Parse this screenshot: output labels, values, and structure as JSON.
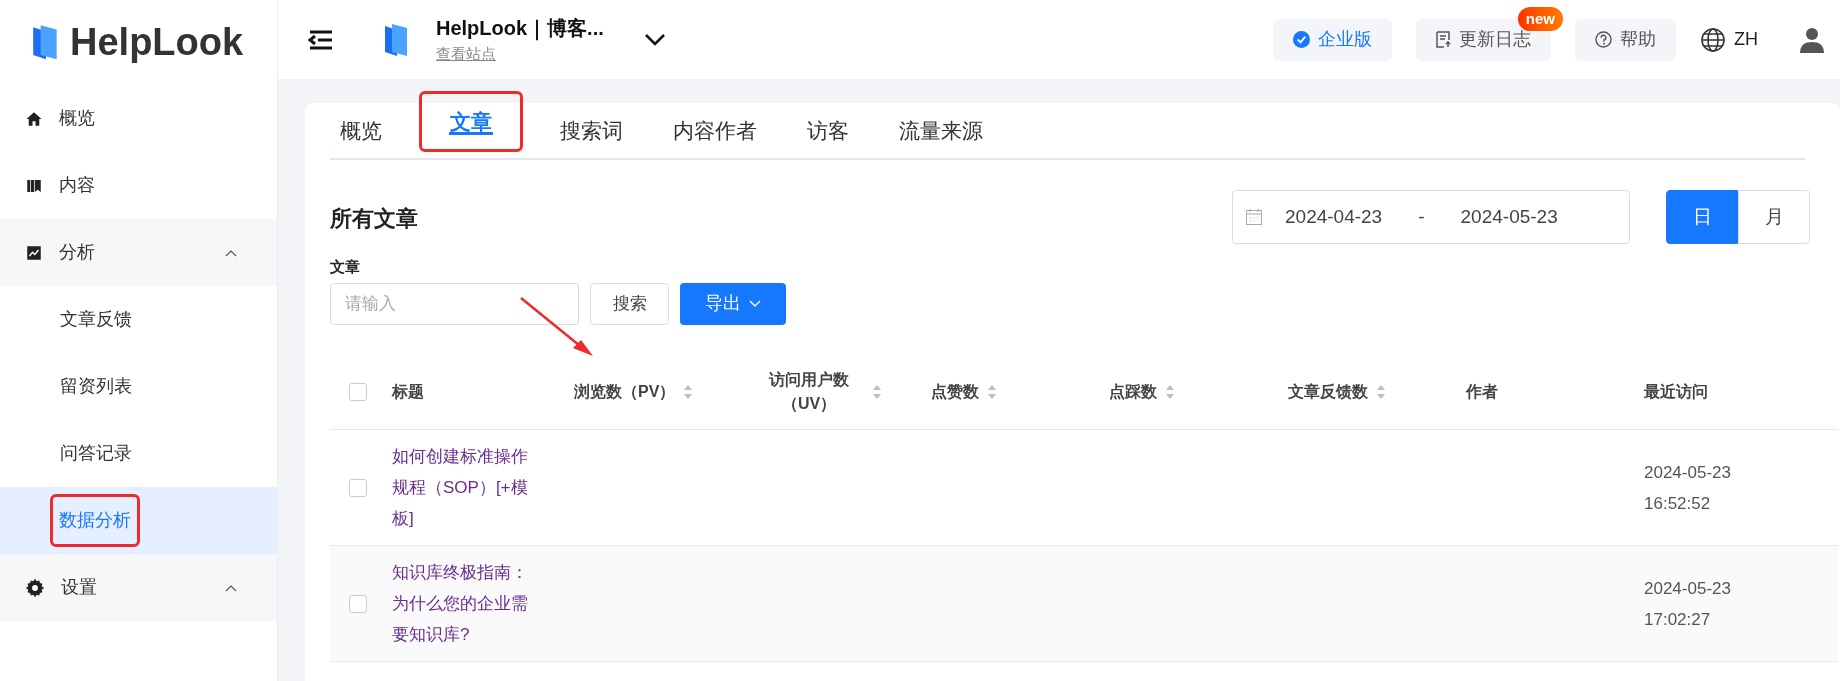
{
  "brand": {
    "name": "HelpLook"
  },
  "header": {
    "site_title": "HelpLook｜博客...",
    "site_link": "查看站点",
    "plan": "企业版",
    "changelog": "更新日志",
    "changelog_badge": "new",
    "help": "帮助",
    "language": "ZH"
  },
  "sidebar": {
    "items": [
      {
        "label": "概览",
        "selected": false
      },
      {
        "label": "内容",
        "selected": false
      },
      {
        "label": "分析",
        "selected": false,
        "expanded": true,
        "children": [
          {
            "label": "文章反馈",
            "selected": false,
            "highlighted": false
          },
          {
            "label": "留资列表",
            "selected": false,
            "highlighted": false
          },
          {
            "label": "问答记录",
            "selected": false,
            "highlighted": false
          },
          {
            "label": "数据分析",
            "selected": true,
            "highlighted": true
          }
        ]
      },
      {
        "label": "设置",
        "selected": false,
        "expanded": true
      }
    ]
  },
  "tabs": [
    {
      "label": "概览",
      "selected": false,
      "highlighted": false
    },
    {
      "label": "文章",
      "selected": true,
      "highlighted": true
    },
    {
      "label": "搜索词",
      "selected": false,
      "highlighted": false
    },
    {
      "label": "内容作者",
      "selected": false,
      "highlighted": false
    },
    {
      "label": "访客",
      "selected": false,
      "highlighted": false
    },
    {
      "label": "流量来源",
      "selected": false,
      "highlighted": false
    }
  ],
  "section_title": "所有文章",
  "date_range": {
    "start": "2024-04-23",
    "separator": "-",
    "end": "2024-05-23"
  },
  "granularity": [
    {
      "label": "日",
      "selected": true
    },
    {
      "label": "月",
      "selected": false
    }
  ],
  "filter": {
    "label": "文章",
    "placeholder": "请输入",
    "search_button": "搜索",
    "export_button": "导出"
  },
  "table": {
    "all_checked": false,
    "columns": [
      {
        "label": "标题",
        "sortable": false
      },
      {
        "label": "浏览数（PV）",
        "sortable": true
      },
      {
        "label": "访问用户数（UV）",
        "sortable": true
      },
      {
        "label": "点赞数",
        "sortable": true
      },
      {
        "label": "点踩数",
        "sortable": true
      },
      {
        "label": "文章反馈数",
        "sortable": true
      },
      {
        "label": "作者",
        "sortable": false
      },
      {
        "label": "最近访问",
        "sortable": false
      }
    ],
    "rows": [
      {
        "checked": false,
        "title": "如何创建标准操作规程（SOP）[+模板]",
        "last_visit": [
          "2024-05-23",
          "16:52:52"
        ]
      },
      {
        "checked": false,
        "title": "知识库终极指南：为什么您的企业需要知识库?",
        "last_visit": [
          "2024-05-23",
          "17:02:27"
        ]
      }
    ]
  }
}
